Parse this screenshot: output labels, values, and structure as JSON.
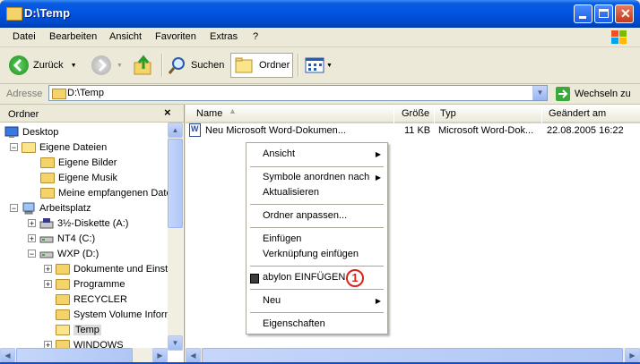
{
  "window": {
    "title": "D:\\Temp"
  },
  "menu": [
    "Datei",
    "Bearbeiten",
    "Ansicht",
    "Favoriten",
    "Extras",
    "?"
  ],
  "toolbar": {
    "back_label": "Zurück",
    "search_label": "Suchen",
    "folders_label": "Ordner"
  },
  "address": {
    "label": "Adresse",
    "value": "D:\\Temp",
    "go_label": "Wechseln zu"
  },
  "folder_pane": {
    "title": "Ordner",
    "close": "×",
    "tree": [
      {
        "label": "Desktop"
      },
      {
        "label": "Eigene Dateien"
      },
      {
        "label": "Eigene Bilder"
      },
      {
        "label": "Eigene Musik"
      },
      {
        "label": "Meine empfangenen Date"
      },
      {
        "label": "Arbeitsplatz"
      },
      {
        "label": "3½-Diskette (A:)"
      },
      {
        "label": "NT4 (C:)"
      },
      {
        "label": "WXP (D:)"
      },
      {
        "label": "Dokumente und Einste"
      },
      {
        "label": "Programme"
      },
      {
        "label": "RECYCLER"
      },
      {
        "label": "System Volume Inforn"
      },
      {
        "label": "Temp"
      },
      {
        "label": "WINDOWS"
      }
    ]
  },
  "list": {
    "columns": {
      "name": "Name",
      "size": "Größe",
      "type": "Typ",
      "modified": "Geändert am"
    },
    "rows": [
      {
        "name": "Neu Microsoft Word-Dokumen...",
        "size": "11 KB",
        "type": "Microsoft Word-Dok...",
        "modified": "22.08.2005 16:22"
      }
    ]
  },
  "context_menu": {
    "items": [
      {
        "label": "Ansicht",
        "submenu": true
      },
      {
        "label": "Symbole anordnen nach",
        "submenu": true
      },
      {
        "label": "Aktualisieren"
      },
      {
        "label": "Ordner anpassen..."
      },
      {
        "label": "Einfügen"
      },
      {
        "label": "Verknüpfung einfügen"
      },
      {
        "label": "abylon EINFÜGEN"
      },
      {
        "label": "Neu",
        "submenu": true
      },
      {
        "label": "Eigenschaften"
      }
    ],
    "callout_number": "1"
  },
  "colors": {
    "titlebar": "#0053e0",
    "callout": "#d8231b",
    "selection": "#316ac5"
  }
}
